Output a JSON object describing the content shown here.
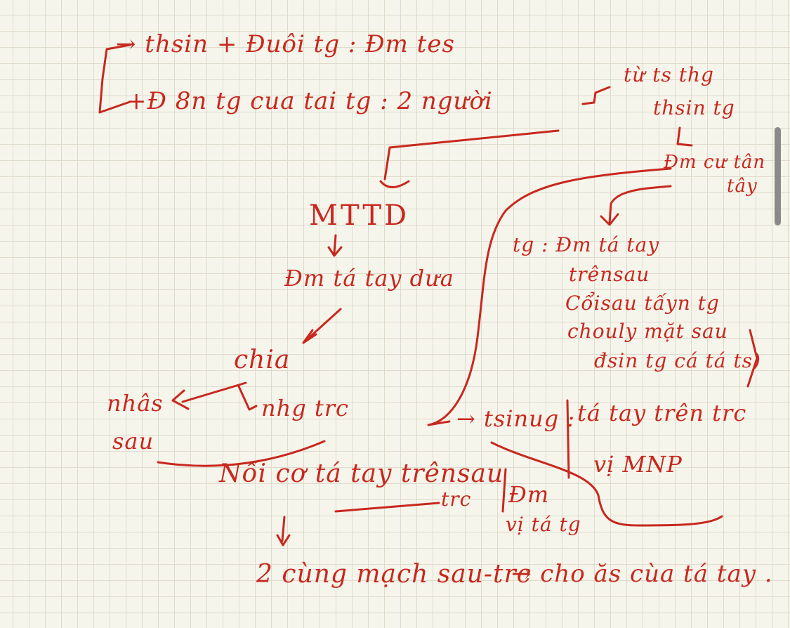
{
  "colors": {
    "ink": "#c8281e",
    "background": "#f6f5ec",
    "grid": "#dedbcc",
    "scrollbar": "#8a8a8a"
  },
  "notes": {
    "line1": "→ thsin + Đuôi tg : Đm tes",
    "line2": "+Đ 8n tg cua tai tg : 2 người",
    "right_top": "từ ts thg",
    "right_top2": "thsin tg",
    "dm_cu_tan": "Đm cư tân",
    "tay": "tây",
    "mttd": "MTTD",
    "dm_ta_tay_dua": "Đm tá tay dưa",
    "chia": "chia",
    "nhas": "nhâs",
    "san": "sau",
    "nhg_tric": "nhg trc",
    "tg_label": "tg : Đm tá tay",
    "tg_l2": "trênsau",
    "tg_l3": "Cổisau tấyn tg",
    "tg_l4": "chouly mặt sau",
    "tg_l5": "đsin tg cá tá ts)",
    "thung": "→ tsinug :",
    "ta_tay_tren_tric": "tá tay trên trc",
    "vi_mnp": "vị MNP",
    "noi_cos": "Nối cơ tá tay trênsau",
    "tric": "trc",
    "dm_vi_ta_tay": "Đm",
    "vi_ta_tay": "vị tá tg",
    "bottom_line": "2 cùng mạch sau-trc",
    "bottom_right": "→ cho ăs cùa tá tay ."
  }
}
